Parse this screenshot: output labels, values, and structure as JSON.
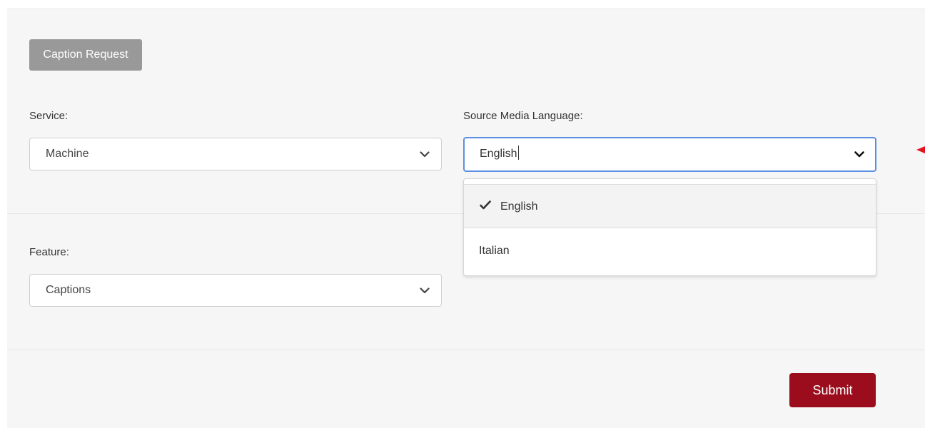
{
  "caption_request_badge": "Caption Request",
  "service": {
    "label": "Service:",
    "selected": "Machine"
  },
  "source_language": {
    "label": "Source Media Language:",
    "input_value": "English",
    "options": [
      {
        "label": "English",
        "selected": true
      },
      {
        "label": "Italian",
        "selected": false
      }
    ]
  },
  "feature": {
    "label": "Feature:",
    "selected": "Captions"
  },
  "submit_label": "Submit",
  "icons": {
    "chevron": "chevron-down-icon",
    "check": "check-icon",
    "annotation": "red-arrow-icon"
  },
  "colors": {
    "submit_bg": "#9b0d1c",
    "focus_border": "#5b8fe0",
    "badge_bg": "#999999",
    "annotation_arrow": "#e0141e"
  }
}
